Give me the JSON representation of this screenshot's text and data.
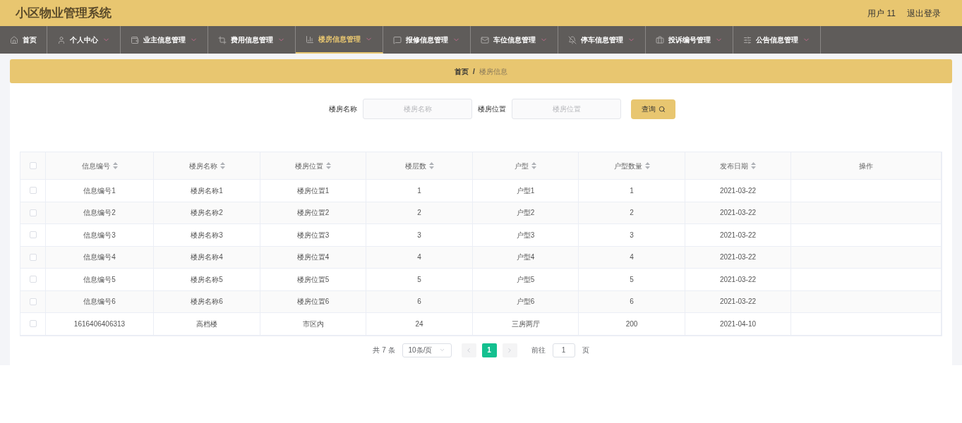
{
  "header": {
    "title": "小区物业管理系统",
    "user": "用户 11",
    "logout": "退出登录"
  },
  "nav": [
    {
      "label": "首页",
      "dropdown": false,
      "selected": false
    },
    {
      "label": "个人中心",
      "dropdown": true,
      "selected": false
    },
    {
      "label": "业主信息管理",
      "dropdown": true,
      "selected": false
    },
    {
      "label": "费用信息管理",
      "dropdown": true,
      "selected": false
    },
    {
      "label": "楼房信息管理",
      "dropdown": true,
      "selected": true
    },
    {
      "label": "报修信息管理",
      "dropdown": true,
      "selected": false
    },
    {
      "label": "车位信息管理",
      "dropdown": true,
      "selected": false
    },
    {
      "label": "停车信息管理",
      "dropdown": true,
      "selected": false
    },
    {
      "label": "投诉编号管理",
      "dropdown": true,
      "selected": false
    },
    {
      "label": "公告信息管理",
      "dropdown": true,
      "selected": false
    }
  ],
  "breadcrumb": {
    "home": "首页",
    "separator": "/",
    "current": "楼房信息"
  },
  "search": {
    "fields": [
      {
        "label": "楼房名称",
        "placeholder": "楼房名称"
      },
      {
        "label": "楼房位置",
        "placeholder": "楼房位置"
      }
    ],
    "button": "查询"
  },
  "table": {
    "select_all_checked": false,
    "columns": [
      {
        "label": "信息编号",
        "sortable": true
      },
      {
        "label": "楼房名称",
        "sortable": true
      },
      {
        "label": "楼房位置",
        "sortable": true
      },
      {
        "label": "楼层数",
        "sortable": true
      },
      {
        "label": "户型",
        "sortable": true
      },
      {
        "label": "户型数量",
        "sortable": true
      },
      {
        "label": "发布日期",
        "sortable": true
      },
      {
        "label": "操作",
        "sortable": false
      }
    ],
    "rows": [
      {
        "checked": false,
        "cells": [
          "信息编号1",
          "楼房名称1",
          "楼房位置1",
          "1",
          "户型1",
          "1",
          "2021-03-22"
        ]
      },
      {
        "checked": false,
        "cells": [
          "信息编号2",
          "楼房名称2",
          "楼房位置2",
          "2",
          "户型2",
          "2",
          "2021-03-22"
        ]
      },
      {
        "checked": false,
        "cells": [
          "信息编号3",
          "楼房名称3",
          "楼房位置3",
          "3",
          "户型3",
          "3",
          "2021-03-22"
        ]
      },
      {
        "checked": false,
        "cells": [
          "信息编号4",
          "楼房名称4",
          "楼房位置4",
          "4",
          "户型4",
          "4",
          "2021-03-22"
        ]
      },
      {
        "checked": false,
        "cells": [
          "信息编号5",
          "楼房名称5",
          "楼房位置5",
          "5",
          "户型5",
          "5",
          "2021-03-22"
        ]
      },
      {
        "checked": false,
        "cells": [
          "信息编号6",
          "楼房名称6",
          "楼房位置6",
          "6",
          "户型6",
          "6",
          "2021-03-22"
        ]
      },
      {
        "checked": false,
        "cells": [
          "1616406406313",
          "高档楼",
          "市区内",
          "24",
          "三房两厅",
          "200",
          "2021-04-10"
        ]
      }
    ]
  },
  "pagination": {
    "total": "共 7 条",
    "page_size": "10条/页",
    "pages": [
      {
        "label": "1",
        "selected": true
      }
    ],
    "goto_label": "前往",
    "goto_value": "1",
    "goto_suffix": "页"
  }
}
